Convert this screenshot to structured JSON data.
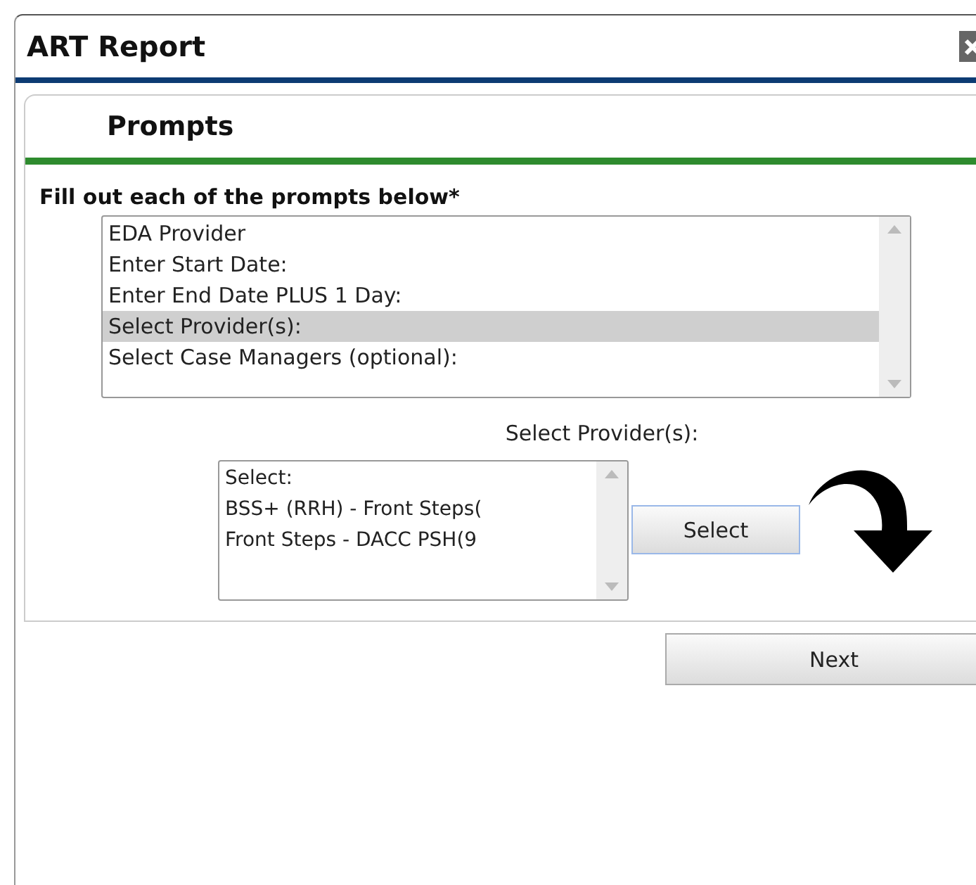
{
  "window": {
    "title": "ART Report"
  },
  "panel": {
    "title": "Prompts"
  },
  "instruction": "Fill out each of the prompts below",
  "required_mark": "*",
  "prompts": [
    {
      "label": "EDA Provider",
      "selected": false
    },
    {
      "label": "Enter Start Date:",
      "selected": false
    },
    {
      "label": "Enter End Date PLUS 1 Day:",
      "selected": false
    },
    {
      "label": "Select Provider(s):",
      "selected": true
    },
    {
      "label": "Select Case Managers (optional):",
      "selected": false
    }
  ],
  "provider_prompt": {
    "label": "Select Provider(s):",
    "options": [
      {
        "label": "Select:",
        "selected": false
      },
      {
        "label": "BSS+ (RRH) - Front Steps(",
        "selected": false
      },
      {
        "label": "Front Steps - DACC PSH(9",
        "selected": false
      }
    ],
    "button": "Select"
  },
  "buttons": {
    "next": "Next"
  }
}
